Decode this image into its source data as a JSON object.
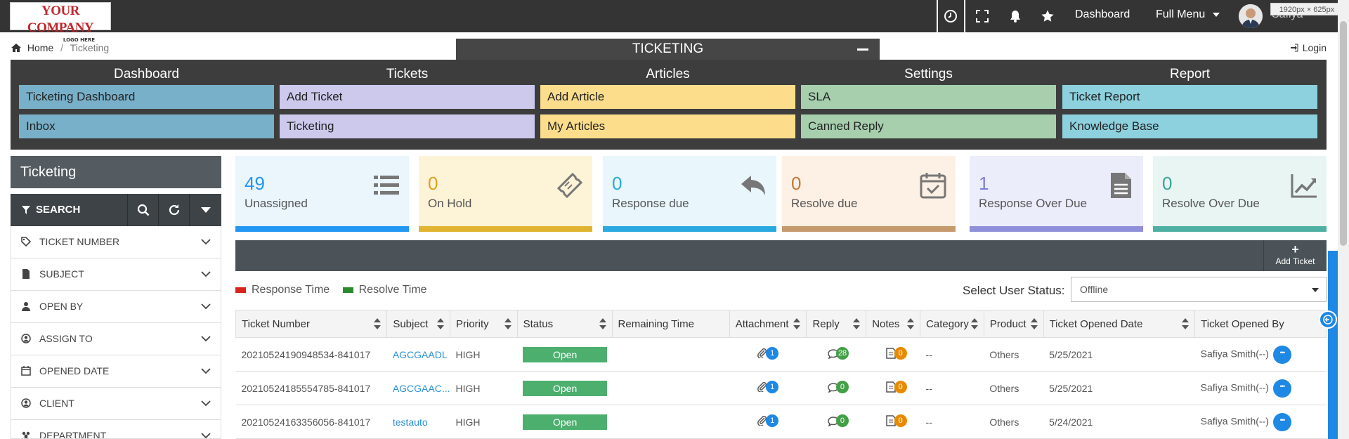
{
  "topbar": {
    "logo_line1": "YOUR COMPANY",
    "logo_line2": "LOGO HERE",
    "dashboard": "Dashboard",
    "full_menu": "Full Menu",
    "user": "Safiya",
    "dim_tag": "1920px × 625px",
    "icons": [
      "clock-icon",
      "fullscreen-icon",
      "bell-icon",
      "star-icon"
    ]
  },
  "breadcrumb": {
    "home": "Home",
    "current": "Ticketing"
  },
  "login": "Login",
  "panel_title": "TICKETING",
  "menu": {
    "columns": [
      {
        "head": "Dashboard",
        "color": "#79b0c9",
        "items": [
          "Ticketing Dashboard",
          "Inbox"
        ]
      },
      {
        "head": "Tickets",
        "color": "#cdc9ed",
        "items": [
          "Add Ticket",
          "Ticketing"
        ]
      },
      {
        "head": "Articles",
        "color": "#fbdd8b",
        "items": [
          "Add Article",
          "My Articles"
        ]
      },
      {
        "head": "Settings",
        "color": "#a7cfae",
        "items": [
          "SLA",
          "Canned Reply"
        ]
      },
      {
        "head": "Report",
        "color": "#8dd0de",
        "items": [
          "Ticket Report",
          "Knowledge Base"
        ]
      }
    ]
  },
  "sidebar": {
    "title": "Ticketing",
    "search_label": "SEARCH",
    "filters": [
      "TICKET NUMBER",
      "SUBJECT",
      "OPEN BY",
      "ASSIGN TO",
      "OPENED DATE",
      "CLIENT",
      "DEPARTMENT"
    ]
  },
  "cards": [
    {
      "value": "49",
      "label": "Unassigned",
      "bg": "#eaf5fc",
      "bar": "#2196f3",
      "num_color": "#2196f3",
      "icon": "list-icon"
    },
    {
      "value": "0",
      "label": "On Hold",
      "bg": "#fdf3d6",
      "bar": "#e0b430",
      "num_color": "#e0a020",
      "icon": "ticket-icon"
    },
    {
      "value": "0",
      "label": "Response due",
      "bg": "#e9f6fb",
      "bar": "#29a9df",
      "num_color": "#29a9df",
      "icon": "reply-icon"
    },
    {
      "value": "0",
      "label": "Resolve due",
      "bg": "#fdf0e4",
      "bar": "#c79a6e",
      "num_color": "#c07a3a",
      "icon": "calendar-check-icon"
    },
    {
      "value": "1",
      "label": "Response Over Due",
      "bg": "#ecedfb",
      "bar": "#8f90d9",
      "num_color": "#7b7fd4",
      "icon": "document-icon"
    },
    {
      "value": "0",
      "label": "Resolve Over Due",
      "bg": "#e8f5f3",
      "bar": "#4eb0a2",
      "num_color": "#3aa595",
      "icon": "chart-line-icon"
    }
  ],
  "add_ticket": "Add Ticket",
  "legend": [
    {
      "label": "Response Time",
      "color": "#d9231e"
    },
    {
      "label": "Resolve Time",
      "color": "#2c8a2e"
    }
  ],
  "status_select": {
    "label": "Select User Status:",
    "value": "Offline"
  },
  "table": {
    "headers": [
      "Ticket Number",
      "Subject",
      "Priority",
      "Status",
      "Remaining Time",
      "Attachment",
      "Reply",
      "Notes",
      "Category",
      "Product",
      "Ticket Opened Date",
      "Ticket Opened By"
    ],
    "rows": [
      {
        "number": "20210524190948534-841017",
        "subject": "AGCGAADL",
        "priority": "HIGH",
        "status": "Open",
        "remaining": "",
        "attachment": "1",
        "reply": "28",
        "notes": "0",
        "category": "--",
        "product": "Others",
        "date": "5/25/2021",
        "by": "Safiya Smith(--)"
      },
      {
        "number": "20210524185554785-841017",
        "subject": "AGCGAAC...",
        "priority": "HIGH",
        "status": "Open",
        "remaining": "",
        "attachment": "1",
        "reply": "0",
        "notes": "0",
        "category": "--",
        "product": "Others",
        "date": "5/25/2021",
        "by": "Safiya Smith(--)"
      },
      {
        "number": "20210524163356056-841017",
        "subject": "testauto",
        "priority": "HIGH",
        "status": "Open",
        "remaining": "",
        "attachment": "1",
        "reply": "0",
        "notes": "0",
        "category": "--",
        "product": "Others",
        "date": "5/24/2021",
        "by": "Safiya Smith(--)"
      }
    ]
  }
}
